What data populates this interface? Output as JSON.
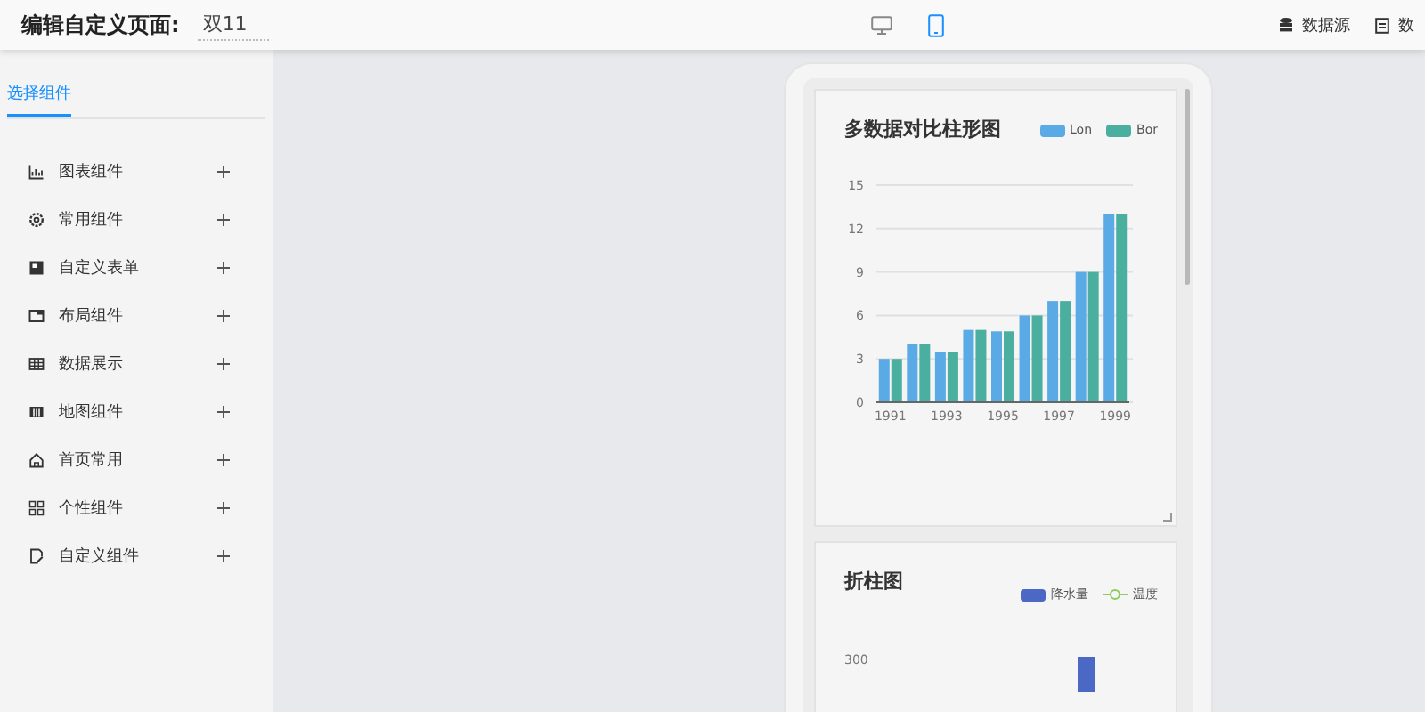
{
  "header": {
    "title": "编辑自定义页面:",
    "page_name": "双11",
    "view_modes": [
      {
        "kind": "desktop",
        "selected": false
      },
      {
        "kind": "mobile",
        "selected": true
      }
    ],
    "actions": [
      "数据源",
      "数"
    ]
  },
  "sidebar": {
    "tab": {
      "label": "选择组件",
      "selected": true
    },
    "items": [
      {
        "label": "图表组件",
        "expanded": false
      },
      {
        "label": "常用组件",
        "expanded": false
      },
      {
        "label": "自定义表单",
        "expanded": false
      },
      {
        "label": "布局组件",
        "expanded": false
      },
      {
        "label": "数据展示",
        "expanded": false
      },
      {
        "label": "地图组件",
        "expanded": false
      },
      {
        "label": "首页常用",
        "expanded": false
      },
      {
        "label": "个性组件",
        "expanded": false
      },
      {
        "label": "自定义组件",
        "expanded": false
      }
    ]
  },
  "preview": {
    "cards": [
      {
        "title": "多数据对比柱形图",
        "chart_data": {
          "type": "bar",
          "grid": true,
          "x": [
            1991,
            1992,
            1993,
            1994,
            1995,
            1996,
            1997,
            1998,
            1999
          ],
          "series": [
            {
              "name": "Lon",
              "color": "#5aaae5",
              "values": [
                3,
                4,
                3.5,
                5,
                4.9,
                6,
                7,
                9,
                13
              ]
            },
            {
              "name": "Bor",
              "color": "#4aaf9e",
              "values": [
                3,
                4,
                3.5,
                5,
                4.9,
                6,
                7,
                9,
                13
              ]
            }
          ],
          "xlim": [
            1990.5,
            1999.5
          ],
          "ylim": [
            0,
            15
          ],
          "yticks": [
            0,
            3,
            6,
            9,
            12,
            15
          ],
          "xticks": [
            1991,
            1993,
            1995,
            1997,
            1999
          ]
        }
      },
      {
        "title": "折柱图",
        "legend": [
          {
            "kind": "bar",
            "label": "降水量",
            "color": "#4a68c4"
          },
          {
            "kind": "line",
            "label": "温度",
            "color": "#8ccc5f"
          }
        ],
        "axis_label": "300"
      }
    ]
  }
}
